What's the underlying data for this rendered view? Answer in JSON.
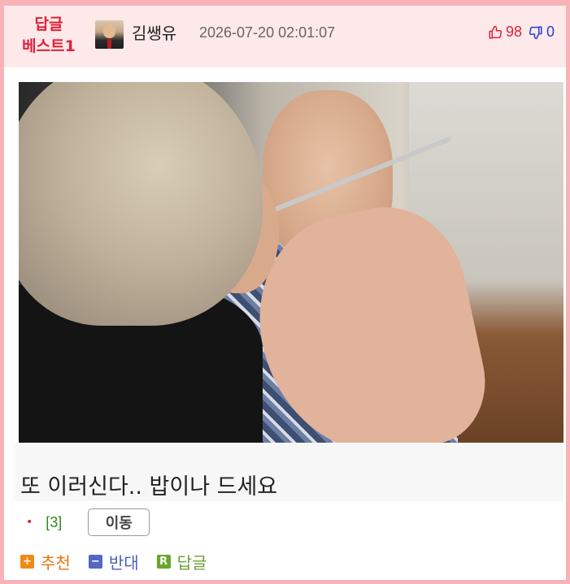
{
  "header": {
    "badge_line1": "답글",
    "badge_line2": "베스트1",
    "author": "김쌩유",
    "timestamp": "2026-07-20 02:01:07",
    "upvotes": "98",
    "downvotes": "0",
    "icons": {
      "up": "thumbs-up-icon",
      "down": "thumbs-down-icon"
    }
  },
  "post": {
    "image": "photo-woman-feeding-elderly-man",
    "title": "또 이러신다.. 밥이나 드세요"
  },
  "meta": {
    "bullet": "•",
    "comment_count": "[3]",
    "move_label": "이동"
  },
  "actions": {
    "recommend_icon": "+",
    "recommend_label": "추천",
    "oppose_icon": "−",
    "oppose_label": "반대",
    "reply_icon": "R",
    "reply_label": "답글"
  },
  "colors": {
    "border": "#f7b3b8",
    "header_bg": "#fde9ea",
    "badge": "#e0213a",
    "upvote": "#e0213a",
    "downvote": "#1d3fd6",
    "comment_count": "#2f8a1a",
    "recommend": "#e8720c",
    "oppose": "#4b62b8",
    "reply": "#6aa034"
  }
}
